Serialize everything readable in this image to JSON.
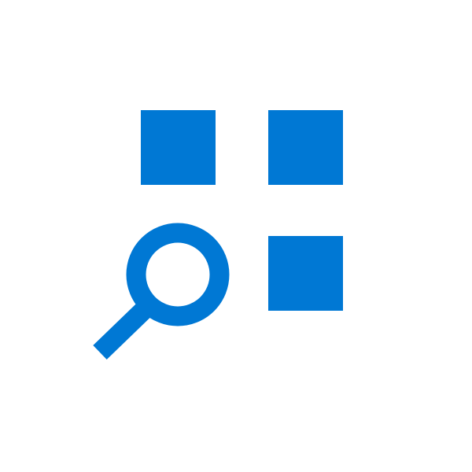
{
  "icon": {
    "name": "app-search-icon",
    "accent_color": "#0078d4",
    "background_color": "#ffffff",
    "parts": {
      "tiles": [
        "app-tile-icon",
        "app-tile-icon",
        "app-tile-icon"
      ],
      "lens": "magnifier-icon"
    }
  }
}
